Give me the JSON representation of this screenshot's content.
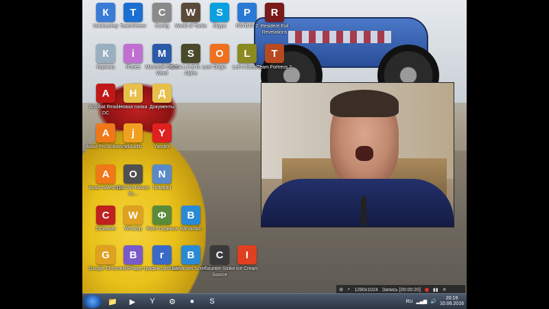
{
  "desktop": {
    "icons": [
      {
        "label": "Компьютер",
        "icon": "computer-icon",
        "color": "#3a7bd5"
      },
      {
        "label": "TeamViewer",
        "icon": "teamviewer-icon",
        "color": "#1a6fd1"
      },
      {
        "label": "Config",
        "icon": "config-icon",
        "color": "#8a8a8a"
      },
      {
        "label": "World of Tanks",
        "icon": "wot-icon",
        "color": "#5a4a3a"
      },
      {
        "label": "Skype",
        "icon": "skype-icon",
        "color": "#0aa0e0"
      },
      {
        "label": "PAYDAY 2",
        "icon": "payday-icon",
        "color": "#2a7ad5"
      },
      {
        "label": "Resident Evil Revelations",
        "icon": "re-icon",
        "color": "#7a1a1a"
      },
      {
        "label": "Корзина",
        "icon": "recycle-bin-icon",
        "color": "#9ab0c0"
      },
      {
        "label": "iTunes",
        "icon": "itunes-icon",
        "color": "#c070d0"
      },
      {
        "label": "Microsoft Office Word",
        "icon": "word-icon",
        "color": "#2a5aa8"
      },
      {
        "label": "S.T.A.L.K.E.R. Lost Alpha",
        "icon": "stalker-icon",
        "color": "#4a4a2a"
      },
      {
        "label": "Origin",
        "icon": "origin-icon",
        "color": "#f07020"
      },
      {
        "label": "Left 4 Dead 2",
        "icon": "l4d2-icon",
        "color": "#8a8a20"
      },
      {
        "label": "Team Fortress 2",
        "icon": "tf2-icon",
        "color": "#b84a20"
      },
      {
        "label": "Acrobat Reader DC",
        "icon": "acrobat-icon",
        "color": "#c01818"
      },
      {
        "label": "Новая папка",
        "icon": "folder-icon",
        "color": "#e6c04a"
      },
      {
        "label": "Документы",
        "icon": "documents-icon",
        "color": "#e6c04a"
      },
      {
        "label": "Avast Pro Antivirus",
        "icon": "avast-icon",
        "color": "#f07818"
      },
      {
        "label": "jetAudio",
        "icon": "jetaudio-icon",
        "color": "#f0a020"
      },
      {
        "label": "Yandex",
        "icon": "yandex-icon",
        "color": "#e02020"
      },
      {
        "label": "Avast SafeZone",
        "icon": "safezone-icon",
        "color": "#f07818"
      },
      {
        "label": "OSCAR Mouse Sc...",
        "icon": "oscar-icon",
        "color": "#505050"
      },
      {
        "label": "Notepad",
        "icon": "notepad-icon",
        "color": "#5a8ac8"
      },
      {
        "label": "CCleaner",
        "icon": "ccleaner-icon",
        "color": "#c02020"
      },
      {
        "label": "Winamp",
        "icon": "winamp-icon",
        "color": "#e0a020"
      },
      {
        "label": "Фото Сервиса",
        "icon": "photo-icon",
        "color": "#5a8a3a"
      },
      {
        "label": "Bandicam",
        "icon": "bandicam-icon",
        "color": "#2a8ad5"
      },
      {
        "label": "Google Chrome",
        "icon": "chrome-icon",
        "color": "#e0a020"
      },
      {
        "label": "BSPlayer",
        "icon": "bsplayer-icon",
        "color": "#7a5ac8"
      },
      {
        "label": "график рабочий",
        "icon": "document-icon",
        "color": "#3a6ac8"
      },
      {
        "label": "Bandicam Screen",
        "icon": "screen-icon",
        "color": "#2a8ad5"
      },
      {
        "label": "Counter-Strike Source",
        "icon": "cs-icon",
        "color": "#3a3a3a"
      },
      {
        "label": "Ice Cream",
        "icon": "icecream-icon",
        "color": "#e04020"
      }
    ]
  },
  "recorder": {
    "resolution": "1280x1024",
    "status": "Запись [00:00:20]"
  },
  "taskbar": {
    "apps": [
      {
        "name": "explorer-icon",
        "glyph": "📁"
      },
      {
        "name": "bsplayer-icon",
        "glyph": "▶"
      },
      {
        "name": "yandex-icon",
        "glyph": "Y"
      },
      {
        "name": "steam-icon",
        "glyph": "⚙"
      },
      {
        "name": "record-icon",
        "glyph": "●"
      },
      {
        "name": "skype-icon",
        "glyph": "S"
      }
    ],
    "lang": "RU",
    "time": "20:19",
    "date": "10.06.2016"
  }
}
